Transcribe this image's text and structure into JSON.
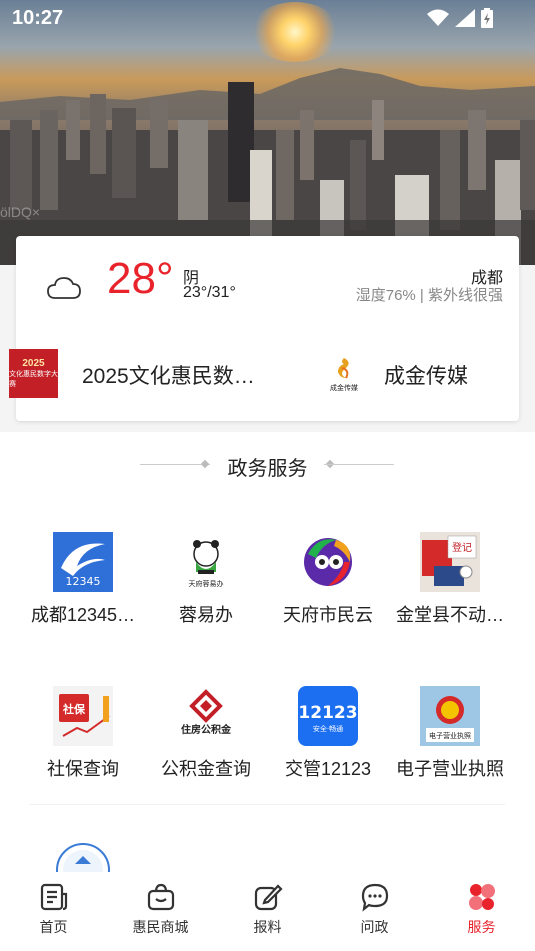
{
  "status_bar": {
    "time": "10:27"
  },
  "hero": {
    "watermark": "ölDQ×"
  },
  "weather": {
    "temperature": "28°",
    "condition": "阴",
    "range": "23°/31°",
    "city": "成都",
    "details": "湿度76% | 紫外线很强"
  },
  "promos": [
    {
      "label": "2025文化惠民数…",
      "thumb_year": "2025",
      "thumb_text": "文化惠民数字大赛"
    },
    {
      "label": "成金传媒",
      "logo_text": "成金传媒"
    }
  ],
  "section": {
    "title": "政务服务"
  },
  "services": [
    {
      "label": "成都12345…",
      "icon": "chengdu-12345-icon",
      "icon_text": "12345"
    },
    {
      "label": "蓉易办",
      "icon": "rongyiban-panda-icon",
      "icon_text": "天府蓉易办"
    },
    {
      "label": "天府市民云",
      "icon": "tianfu-cloud-icon"
    },
    {
      "label": "金堂县不动…",
      "icon": "jintang-property-icon",
      "icon_text": "登记"
    },
    {
      "label": "社保查询",
      "icon": "social-security-icon",
      "icon_text": "社保"
    },
    {
      "label": "公积金查询",
      "icon": "housing-fund-icon",
      "icon_text": "住房公积金"
    },
    {
      "label": "交管12123",
      "icon": "traffic-12123-icon",
      "icon_text": "12123",
      "icon_subtext": "安全·畅通"
    },
    {
      "label": "电子营业执照",
      "icon": "business-license-icon",
      "icon_text": "电子营业执照"
    }
  ],
  "nav": [
    {
      "label": "首页",
      "icon": "document-icon"
    },
    {
      "label": "惠民商城",
      "icon": "shopping-bag-icon"
    },
    {
      "label": "报料",
      "icon": "edit-icon"
    },
    {
      "label": "问政",
      "icon": "chat-bubble-icon"
    },
    {
      "label": "服务",
      "icon": "services-icon",
      "active": true
    }
  ],
  "colors": {
    "accent": "#e8232c",
    "text": "#222222",
    "muted": "#888888"
  }
}
